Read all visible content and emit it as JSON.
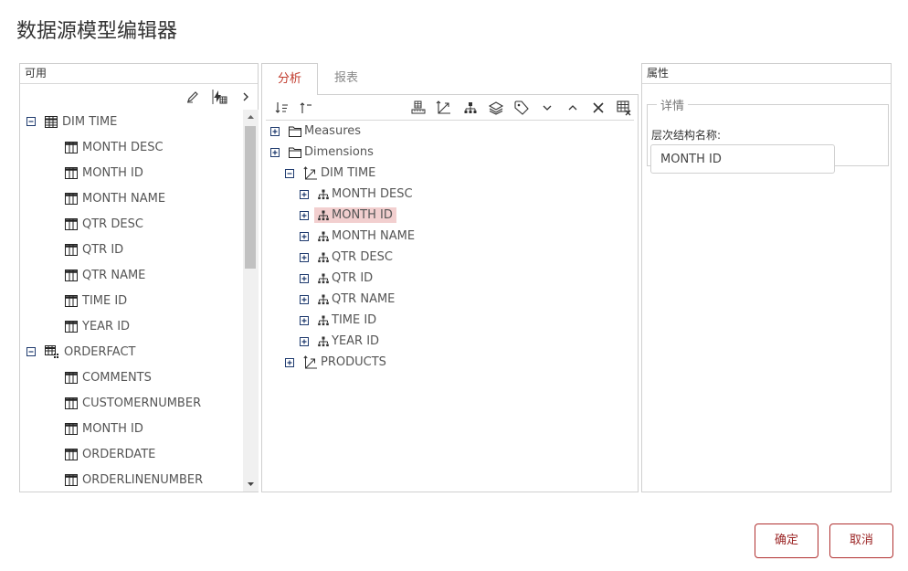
{
  "title": "数据源模型编辑器",
  "left_panel": {
    "header": "可用",
    "toolbar": [
      "pencil-icon",
      "calculated-field-icon",
      "chevron-right-icon"
    ],
    "tree": [
      {
        "label": "DIM TIME",
        "type": "table",
        "toggle": "minus"
      },
      {
        "label": "MONTH DESC",
        "type": "column"
      },
      {
        "label": "MONTH ID",
        "type": "column"
      },
      {
        "label": "MONTH NAME",
        "type": "column"
      },
      {
        "label": "QTR DESC",
        "type": "column"
      },
      {
        "label": "QTR ID",
        "type": "column"
      },
      {
        "label": "QTR NAME",
        "type": "column"
      },
      {
        "label": "TIME ID",
        "type": "column"
      },
      {
        "label": "YEAR ID",
        "type": "column"
      },
      {
        "label": "ORDERFACT",
        "type": "fact-table",
        "toggle": "minus"
      },
      {
        "label": "COMMENTS",
        "type": "column"
      },
      {
        "label": "CUSTOMERNUMBER",
        "type": "column"
      },
      {
        "label": "MONTH ID",
        "type": "column"
      },
      {
        "label": "ORDERDATE",
        "type": "column"
      },
      {
        "label": "ORDERLINENUMBER",
        "type": "column"
      }
    ]
  },
  "middle_panel": {
    "tabs": [
      {
        "label": "分析",
        "active": true
      },
      {
        "label": "报表",
        "active": false
      }
    ],
    "toolbar_left": [
      "sort-down-icon",
      "sort-up-icon"
    ],
    "toolbar_right": [
      "measure-icon",
      "dimension-icon",
      "hierarchy-icon",
      "layers-icon",
      "tag-icon",
      "chevron-down-icon",
      "chevron-up-icon",
      "close-icon",
      "table-delete-icon"
    ],
    "tree": [
      {
        "label": "Measures",
        "type": "folder",
        "toggle": "plus",
        "level": 0
      },
      {
        "label": "Dimensions",
        "type": "folder",
        "toggle": "plus",
        "level": 0
      },
      {
        "label": "DIM TIME",
        "type": "dimension",
        "toggle": "minus",
        "level": 1
      },
      {
        "label": "MONTH DESC",
        "type": "hierarchy",
        "toggle": "plus",
        "level": 2
      },
      {
        "label": "MONTH ID",
        "type": "hierarchy",
        "toggle": "plus",
        "level": 2,
        "selected": true
      },
      {
        "label": "MONTH NAME",
        "type": "hierarchy",
        "toggle": "plus",
        "level": 2
      },
      {
        "label": "QTR DESC",
        "type": "hierarchy",
        "toggle": "plus",
        "level": 2
      },
      {
        "label": "QTR ID",
        "type": "hierarchy",
        "toggle": "plus",
        "level": 2
      },
      {
        "label": "QTR NAME",
        "type": "hierarchy",
        "toggle": "plus",
        "level": 2
      },
      {
        "label": "TIME ID",
        "type": "hierarchy",
        "toggle": "plus",
        "level": 2
      },
      {
        "label": "YEAR ID",
        "type": "hierarchy",
        "toggle": "plus",
        "level": 2
      },
      {
        "label": "PRODUCTS",
        "type": "dimension",
        "toggle": "plus",
        "level": 1
      }
    ]
  },
  "right_panel": {
    "header": "属性",
    "fieldset_legend": "详情",
    "hierarchy_name_label": "层次结构名称:",
    "hierarchy_name_value": "MONTH ID"
  },
  "buttons": {
    "ok": "确定",
    "cancel": "取消"
  },
  "colors": {
    "accent": "#c0392b",
    "selected_bg": "#f2cfcf",
    "tree_icon": "#1e3a6e"
  }
}
